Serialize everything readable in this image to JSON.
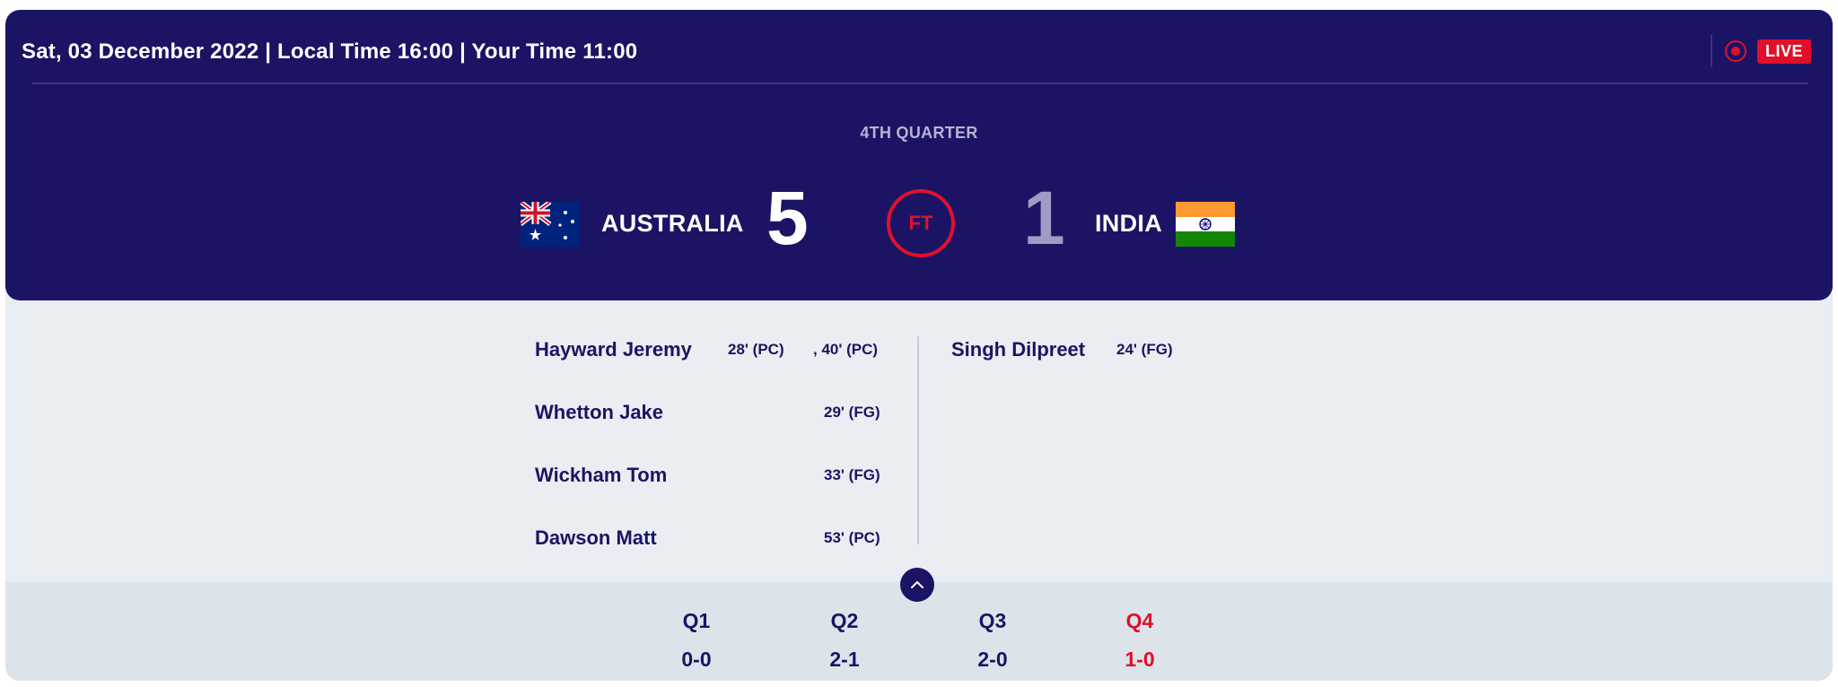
{
  "header": {
    "datetime": "Sat, 03 December 2022 | Local Time 16:00 | Your Time 11:00",
    "live_label": "LIVE"
  },
  "match": {
    "period": "4TH QUARTER",
    "status": "FT",
    "home": {
      "name": "AUSTRALIA",
      "score": "5",
      "flag": "australia-flag-icon"
    },
    "away": {
      "name": "INDIA",
      "score": "1",
      "flag": "india-flag-icon"
    }
  },
  "scorers": {
    "home": [
      {
        "name": "Hayward Jeremy",
        "goals": [
          "28' (PC)",
          ", 40' (PC)"
        ]
      },
      {
        "name": "Whetton Jake",
        "goals": [
          "29' (FG)"
        ]
      },
      {
        "name": "Wickham Tom",
        "goals": [
          "33' (FG)"
        ]
      },
      {
        "name": "Dawson Matt",
        "goals": [
          "53' (PC)"
        ]
      }
    ],
    "away": [
      {
        "name": "Singh Dilpreet",
        "goals": [
          "24' (FG)"
        ]
      }
    ]
  },
  "quarters": [
    {
      "label": "Q1",
      "score": "0-0"
    },
    {
      "label": "Q2",
      "score": "2-1"
    },
    {
      "label": "Q3",
      "score": "2-0"
    },
    {
      "label": "Q4",
      "score": "1-0"
    }
  ],
  "colors": {
    "navy": "#1b1464",
    "accent_red": "#e0102b",
    "light_bg": "#e8eef1",
    "quarter_bg": "#dce4ea"
  }
}
